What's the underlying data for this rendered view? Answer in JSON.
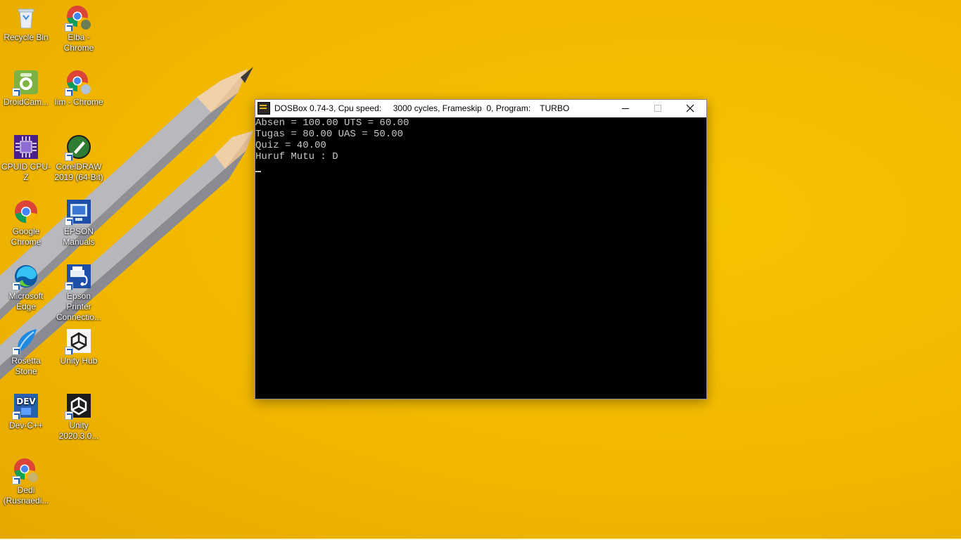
{
  "desktop": {
    "icons": [
      {
        "label": "Recycle Bin",
        "icon": "recycle-bin-icon"
      },
      {
        "label": "Elba - Chrome",
        "icon": "chrome-icon"
      },
      {
        "label": "DroidCam...",
        "icon": "droidcam-icon"
      },
      {
        "label": "Iim - Chrome",
        "icon": "chrome-icon"
      },
      {
        "label": "CPUID CPU-Z",
        "icon": "cpu-z-icon"
      },
      {
        "label": "CorelDRAW 2019 (64-Bit)",
        "icon": "coreldraw-icon"
      },
      {
        "label": "Google Chrome",
        "icon": "chrome-icon"
      },
      {
        "label": "EPSON Manuals",
        "icon": "epson-manuals-icon"
      },
      {
        "label": "Microsoft Edge",
        "icon": "edge-icon"
      },
      {
        "label": "Epson Printer Connectio...",
        "icon": "epson-printer-icon"
      },
      {
        "label": "Rosetta Stone",
        "icon": "rosetta-stone-icon"
      },
      {
        "label": "Unity Hub",
        "icon": "unity-icon"
      },
      {
        "label": "Dev-C++",
        "icon": "devcpp-icon"
      },
      {
        "label": "Unity 2020.3.0...",
        "icon": "unity-icon"
      },
      {
        "label": "Dedi (Rusnaedi...",
        "icon": "chrome-icon"
      }
    ]
  },
  "window": {
    "title": "DOSBox 0.74-3, Cpu speed:     3000 cycles, Frameskip  0, Program:    TURBO",
    "minimize": "minimize",
    "maximize": "maximize",
    "close": "close",
    "console_lines": [
      "Absen = 100.00 UTS = 60.00",
      "Tugas = 80.00 UAS = 50.00",
      "Quiz = 40.00",
      "Huruf Mutu : D"
    ]
  },
  "colors": {
    "wallpaper": "#f2b800",
    "console_bg": "#000000",
    "console_fg": "#c8c8c8"
  }
}
